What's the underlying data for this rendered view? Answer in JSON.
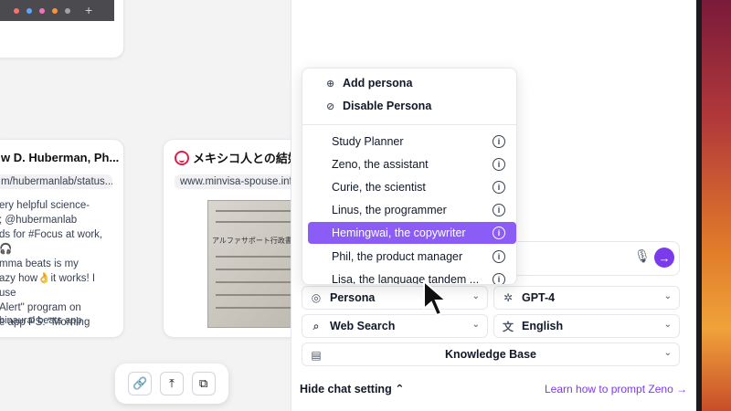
{
  "cards": {
    "left": {
      "title": "w D. Huberman, Ph...",
      "url": "m/hubermanlab/status...",
      "body": "ery helpful science-\n; @hubermanlab\nds for #Focus at work, 🎧\nmma beats is my\nazy how👌it works! I use\nAlert\" program on\ne app PS: \"Morning",
      "footer": "binaural beats app"
    },
    "right": {
      "title": "メキシコ人との結婚",
      "url": "www.minvisa-spouse.info",
      "image_label": "アルファサポート行政書士事務"
    }
  },
  "toolbar": {
    "icons": [
      "link-icon",
      "upload-icon",
      "export-icon"
    ],
    "link_glyph": "🔗",
    "upload_glyph": "⤒",
    "export_glyph": "⧉"
  },
  "dropdown": {
    "actions": [
      {
        "label": "Add persona",
        "icon": "add-circle-icon",
        "glyph": "⊕"
      },
      {
        "label": "Disable Persona",
        "icon": "disable-icon",
        "glyph": "⊘"
      }
    ],
    "items": [
      {
        "label": "Study Planner",
        "selected": false
      },
      {
        "label": "Zeno, the assistant",
        "selected": false
      },
      {
        "label": "Curie, the scientist",
        "selected": false
      },
      {
        "label": "Linus, the programmer",
        "selected": false
      },
      {
        "label": "Hemingwai, the copywriter",
        "selected": true
      },
      {
        "label": "Phil, the product manager",
        "selected": false
      },
      {
        "label": "Lisa, the language tandem ...",
        "selected": false
      }
    ],
    "info_glyph": "i"
  },
  "chat": {
    "mic_glyph": "🎙",
    "send_glyph": "→"
  },
  "settings": {
    "persona": {
      "label": "Persona",
      "glyph": "◎"
    },
    "model": {
      "label": "GPT-4",
      "glyph": "✲"
    },
    "search": {
      "label": "Web Search",
      "glyph": "⌕"
    },
    "language": {
      "label": "English",
      "glyph": "文"
    },
    "knowledge": {
      "label": "Knowledge Base",
      "glyph": "▤"
    },
    "chevron": "⌄"
  },
  "footer": {
    "hide_label": "Hide chat setting ⌃",
    "learn_label": "Learn how to prompt Zeno →"
  },
  "colors": {
    "accent": "#7c3aed",
    "selected_bg": "#8b5cf6"
  }
}
